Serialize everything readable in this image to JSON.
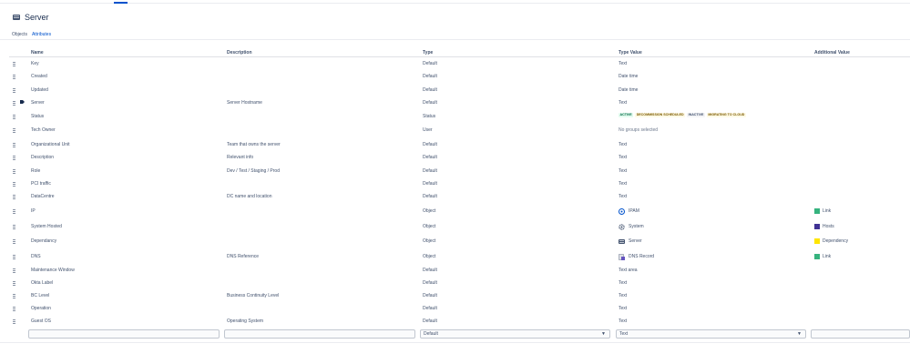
{
  "header": {
    "title": "Server",
    "icon": "server-icon"
  },
  "tabs": [
    {
      "label": "Objects",
      "active": false
    },
    {
      "label": "Attributes",
      "active": true
    }
  ],
  "columns": {
    "name": "Name",
    "description": "Description",
    "type": "Type",
    "type_value": "Type Value",
    "additional_value": "Additional Value"
  },
  "rows": [
    {
      "name": "Key",
      "description": "",
      "type": "Default",
      "type_value": "Text"
    },
    {
      "name": "Created",
      "description": "",
      "type": "Default",
      "type_value": "Date time"
    },
    {
      "name": "Updated",
      "description": "",
      "type": "Default",
      "type_value": "Date time"
    },
    {
      "name": "Server",
      "description": "Server Hostname",
      "type": "Default",
      "type_value": "Text",
      "label_icon": "tag-icon"
    },
    {
      "name": "Status",
      "description": "",
      "type": "Status",
      "statuses": [
        {
          "label": "ACTIVE",
          "color": "green"
        },
        {
          "label": "DECOMMISSION SCHEDULED",
          "color": "yellow"
        },
        {
          "label": "INACTIVE",
          "color": "grey"
        },
        {
          "label": "MIGRATING TO CLOUD",
          "color": "yellow"
        }
      ]
    },
    {
      "name": "Tech Owner",
      "description": "",
      "type": "User",
      "type_value": "No groups selected",
      "muted": true
    },
    {
      "name": "Organizational Unit",
      "description": "Team that owns the server",
      "type": "Default",
      "type_value": "Text"
    },
    {
      "name": "Description",
      "description": "Relevant info",
      "type": "Default",
      "type_value": "Text"
    },
    {
      "name": "Role",
      "description": "Dev / Test / Staging / Prod",
      "type": "Default",
      "type_value": "Text"
    },
    {
      "name": "PCI traffic",
      "description": "",
      "type": "Default",
      "type_value": "Text"
    },
    {
      "name": "DataCentre",
      "description": "DC name and location",
      "type": "Default",
      "type_value": "Text"
    },
    {
      "name": "IP",
      "description": "",
      "type": "Object",
      "type_value": "IPAM",
      "ref_icon": "ipam-icon",
      "additional": "Link",
      "additional_color": "#36b37e"
    },
    {
      "name": "System Hosted",
      "description": "",
      "type": "Object",
      "type_value": "System",
      "ref_icon": "system-gear-icon",
      "additional": "Hosts",
      "additional_color": "#403294"
    },
    {
      "name": "Dependancy",
      "description": "",
      "type": "Object",
      "type_value": "Server",
      "ref_icon": "server-icon",
      "additional": "Dependency",
      "additional_color": "#ffe500"
    },
    {
      "name": "DNS",
      "description": "DNS Reference",
      "type": "Object",
      "type_value": "DNS Record",
      "ref_icon": "dns-record-icon",
      "additional": "Link",
      "additional_color": "#36b37e"
    },
    {
      "name": "Maintenance Window",
      "description": "",
      "type": "Default",
      "type_value": "Text area"
    },
    {
      "name": "Okta Label",
      "description": "",
      "type": "Default",
      "type_value": "Text"
    },
    {
      "name": "BC Level",
      "description": "Business Continuity Level",
      "type": "Default",
      "type_value": "Text"
    },
    {
      "name": "Operation",
      "description": "",
      "type": "Default",
      "type_value": "Text"
    },
    {
      "name": "Guest OS",
      "description": "Operating System",
      "type": "Default",
      "type_value": "Text"
    }
  ],
  "new_attribute": {
    "name_value": "",
    "description_value": "",
    "type_value": "Default",
    "type_value_value": "Text"
  }
}
